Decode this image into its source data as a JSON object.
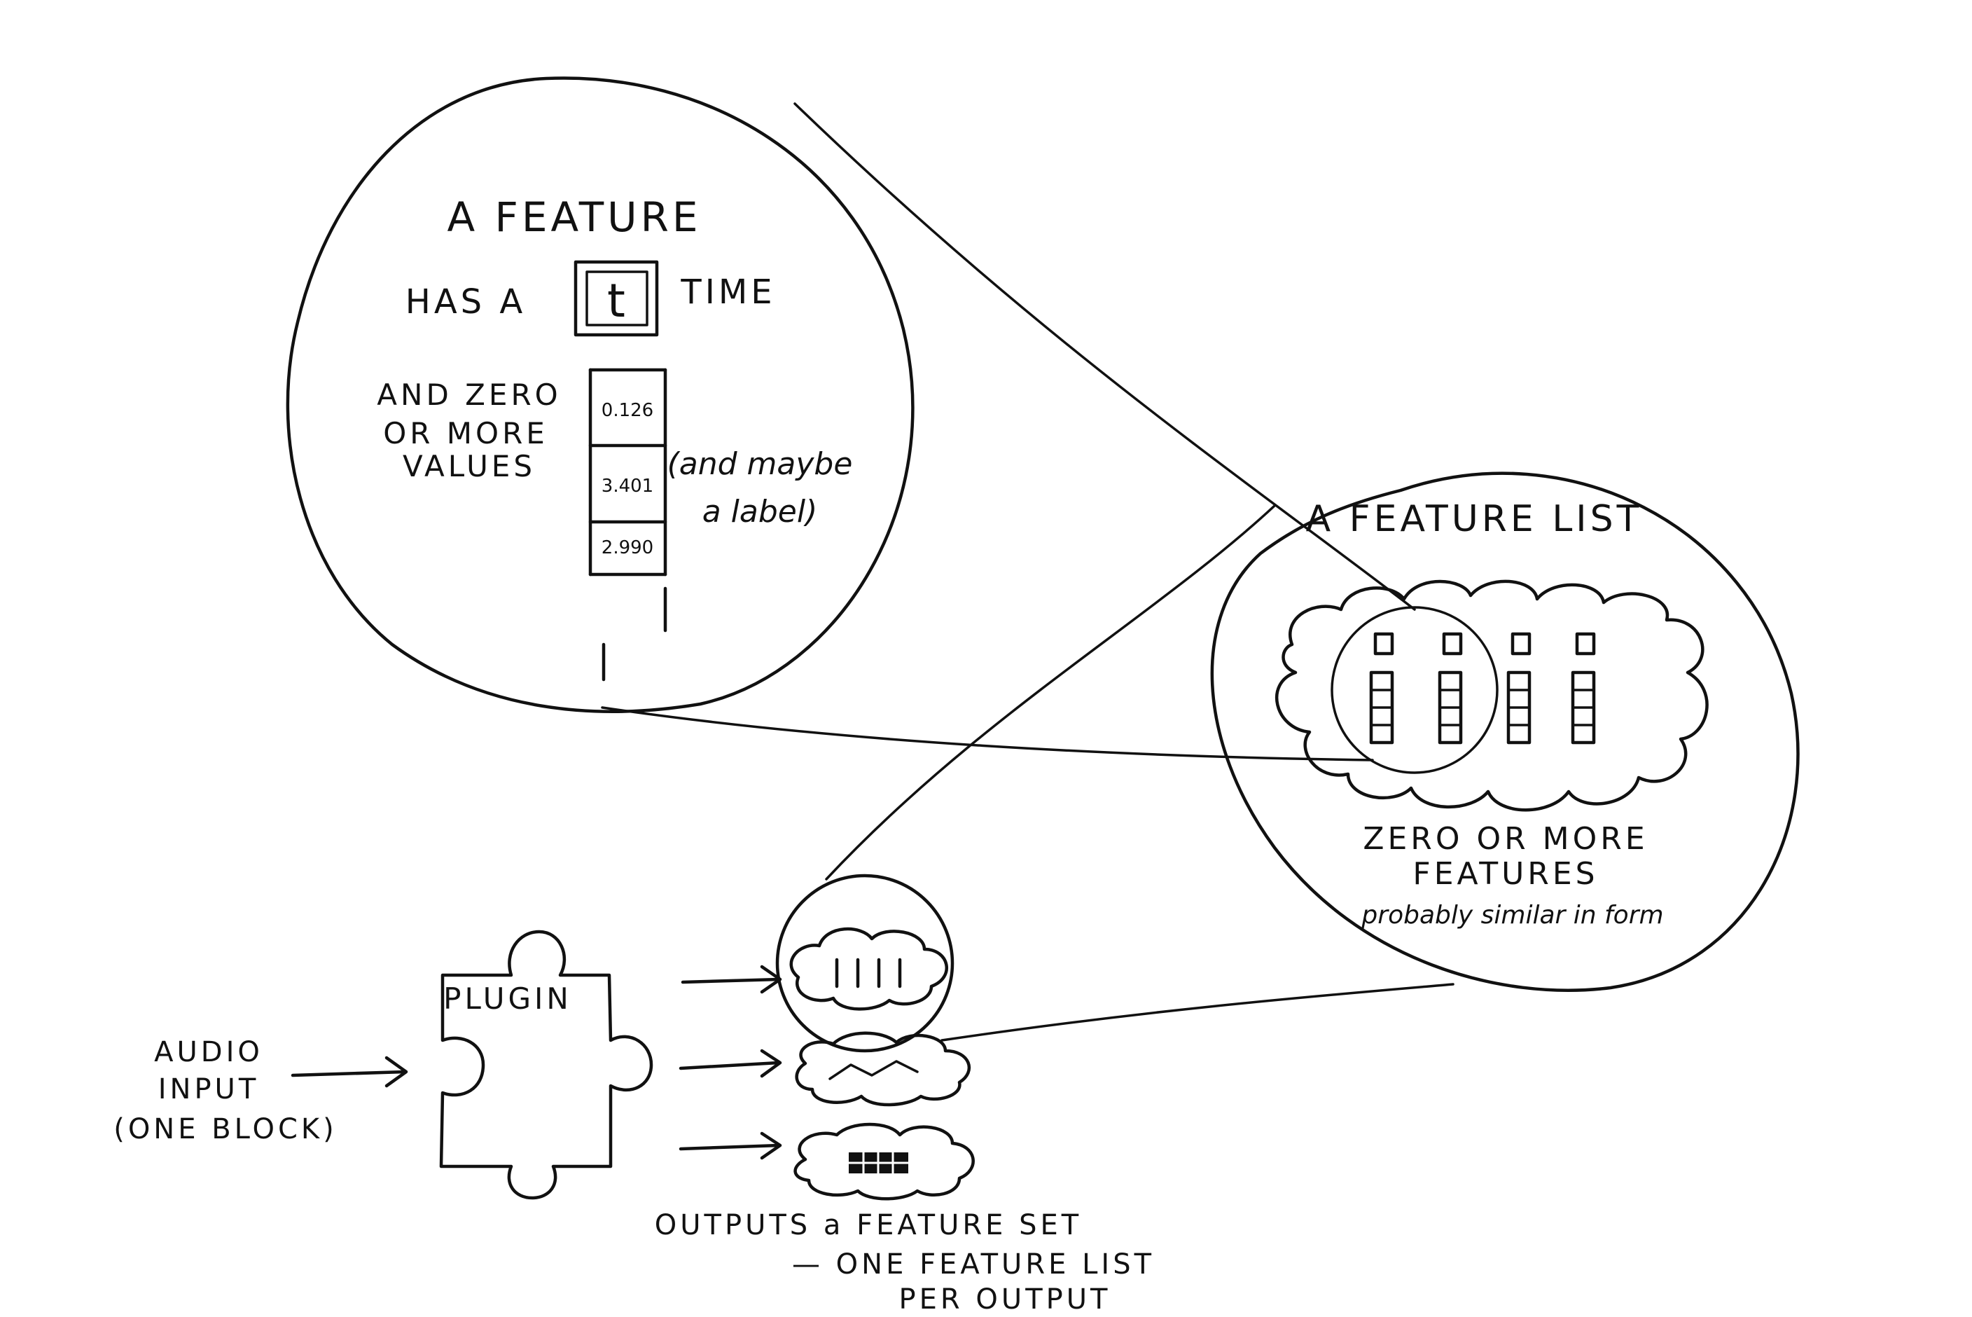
{
  "feature": {
    "title": "A FEATURE",
    "has_a": "HAS A",
    "time_symbol": "t",
    "time_word": "TIME",
    "values_text_lines": [
      "AND ZERO",
      "OR MORE",
      "VALUES"
    ],
    "values": [
      "0.126",
      "3.401",
      "2.990"
    ],
    "label_note_lines": [
      "(and maybe",
      "a label)"
    ]
  },
  "feature_list": {
    "title": "A FEATURE LIST",
    "caption_lines": [
      "ZERO OR MORE",
      "FEATURES"
    ],
    "caption_note": "probably similar in form"
  },
  "plugin": {
    "label": "PLUGIN",
    "input_lines": [
      "AUDIO",
      "INPUT",
      "(ONE BLOCK)"
    ]
  },
  "outputs": {
    "caption_lines": [
      "OUTPUTS a FEATURE SET",
      "— ONE FEATURE LIST",
      "PER OUTPUT"
    ]
  },
  "icons": {
    "time_box": "time-box-icon",
    "value_column": "value-column-icon",
    "cloud": "cloud-icon",
    "puzzle_piece": "puzzle-piece-icon",
    "arrow": "arrow-icon"
  },
  "colors": {
    "ink": "#111111",
    "paper": "#ffffff"
  }
}
